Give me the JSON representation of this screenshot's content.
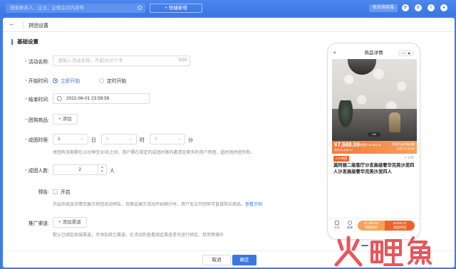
{
  "topbar": {
    "search_placeholder": "搜索联系人、企业、企微会话内容等",
    "quick_new": "+ 快捷新增",
    "service": "联系微客服"
  },
  "subheader": {
    "back_glyph": "←",
    "title": "拼团设置"
  },
  "section_title": "基础设置",
  "form": {
    "activity_name": {
      "label": "活动名称:",
      "placeholder": "请输入活动名称，不超过20个字",
      "counter": "0/20"
    },
    "start_time": {
      "label": "开始时间:",
      "opt1": "立即开始",
      "opt2": "定时开始"
    },
    "end_time": {
      "label": "结束时间:",
      "value": "2022-06-01 23:59:59"
    },
    "product": {
      "label": "团购商品:",
      "button": "+ 添加"
    },
    "time_limit": {
      "label": "成团时限:",
      "day_value": "1",
      "day_unit": "日",
      "hour_value": "0",
      "hour_unit": "时",
      "min_value": "0",
      "min_unit": "分",
      "hint": "拼团有效期需在15分钟至30天之间，用户需在规定的成团时限内邀请足够多的用户参团，超时则拼团失败。"
    },
    "group_size": {
      "label": "成团人数:",
      "value": "2",
      "unit": "人"
    },
    "preview": {
      "label": "预告:",
      "checkbox_label": "开启",
      "hint": "开启后商品详情页展示拼团活动预告，页面会展示活动开始倒计时，用户无法开团但可直接购买商品。",
      "link": "查看示例"
    },
    "channel": {
      "label": "推广渠道:",
      "button": "+ 添加渠道",
      "hint": "默认已绑定商城渠道，可添加其它渠道，在活动的查看绑定渠道里可进行绑定、禁用等操作"
    }
  },
  "phone": {
    "nav_title": "商品详情",
    "nav_back": "<",
    "nav_capsule": "•••  ◉",
    "image_indicator": "1/6",
    "price": "¥7,888.99",
    "price_extra": "拼团价 ¥8,888.00",
    "orig_price": "原价¥6,888.00",
    "countdown_label": "距离活动开始还剩",
    "countdown_value": "00天 12:31:30",
    "group_tag": "2人拼团",
    "share": "分享",
    "product_name": "莫阿丽二级客厅沙发高级奢华完美沙发四人沙发高级奢华完美沙发四人",
    "footer": {
      "home": "主页",
      "service": "客服",
      "buy_price": "¥7,888.99",
      "buy_label": "单独购买",
      "group_price": "¥6488.00",
      "group_label": "发起拼团"
    }
  },
  "bottom": {
    "cancel": "取消",
    "ok": "确定"
  },
  "watermark": {
    "text": "火鲤鱼"
  },
  "colors": {
    "primary": "#3b76e2",
    "orange": "#f0622a",
    "required": "#e5484d"
  }
}
